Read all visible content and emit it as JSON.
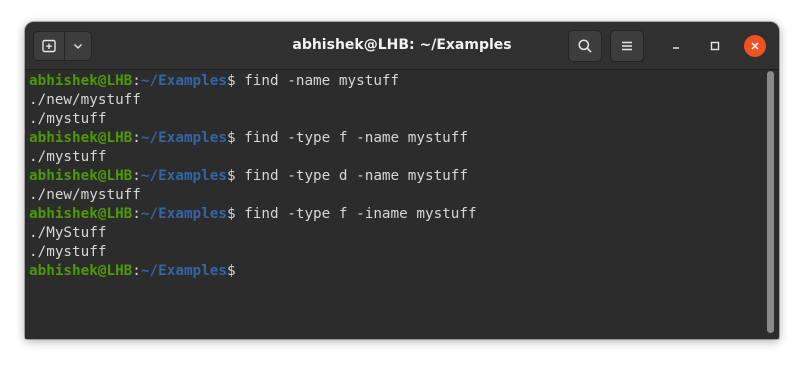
{
  "window": {
    "title": "abhishek@LHB: ~/Examples"
  },
  "titlebar": {
    "new_tab_icon": "new-tab-icon",
    "dropdown_icon": "chevron-down-icon",
    "search_icon": "search-icon",
    "menu_icon": "hamburger-menu-icon",
    "minimize_icon": "minimize-icon",
    "maximize_icon": "maximize-icon",
    "close_icon": "close-icon",
    "close_color": "#e95420"
  },
  "terminal": {
    "colors": {
      "background": "#2c2c2c",
      "user_host": "#4e9a06",
      "path": "#3465a4",
      "text": "#d6d6d6"
    },
    "prompt": {
      "user_host": "abhishek@LHB",
      "colon": ":",
      "path": "~/Examples",
      "dollar": "$"
    },
    "lines": [
      {
        "type": "prompt",
        "command": " find -name mystuff"
      },
      {
        "type": "output",
        "text": "./new/mystuff"
      },
      {
        "type": "output",
        "text": "./mystuff"
      },
      {
        "type": "prompt",
        "command": " find -type f -name mystuff"
      },
      {
        "type": "output",
        "text": "./mystuff"
      },
      {
        "type": "prompt",
        "command": " find -type d -name mystuff"
      },
      {
        "type": "output",
        "text": "./new/mystuff"
      },
      {
        "type": "prompt",
        "command": " find -type f -iname mystuff"
      },
      {
        "type": "output",
        "text": "./MyStuff"
      },
      {
        "type": "output",
        "text": "./mystuff"
      },
      {
        "type": "prompt",
        "command": ""
      }
    ]
  }
}
